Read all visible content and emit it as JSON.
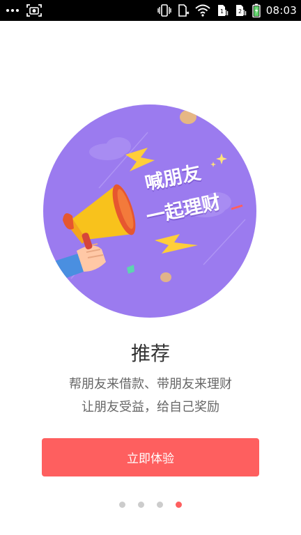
{
  "status_bar": {
    "time": "08:03",
    "icons": [
      "more-dots-icon",
      "screenshot-icon",
      "vibrate-icon",
      "sim-no-signal-icon",
      "wifi-icon",
      "sim1-icon",
      "sim2-icon",
      "battery-charging-icon"
    ]
  },
  "illustration": {
    "line1": "喊朋友",
    "line2": "一起理财",
    "icons": [
      "megaphone-icon",
      "hand-icon",
      "lightning-icon",
      "cloud-icon",
      "coin-icon",
      "sparkle-icon"
    ]
  },
  "content": {
    "title": "推荐",
    "description_line1": "帮朋友来借款、带朋友来理财",
    "description_line2": "让朋友受益，给自己奖励"
  },
  "cta": {
    "label": "立即体验"
  },
  "pager": {
    "total": 4,
    "active_index": 3
  },
  "colors": {
    "accent": "#fe5f5f",
    "circle": "#9b7bef",
    "title_text": "#333333",
    "body_text": "#666666",
    "dot_inactive": "#cccccc"
  }
}
